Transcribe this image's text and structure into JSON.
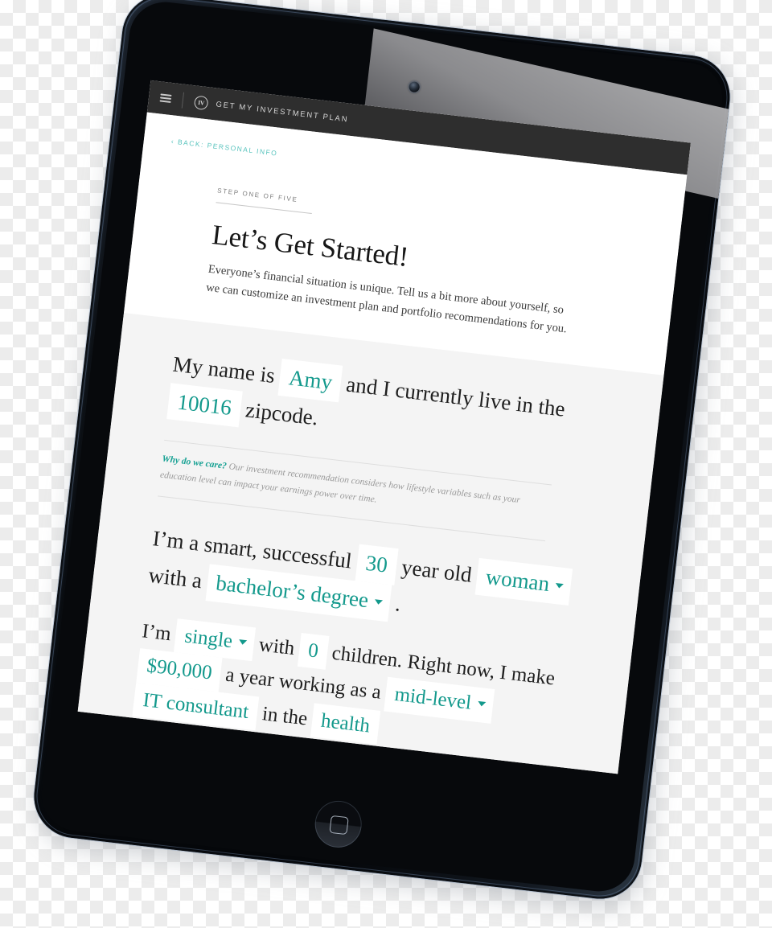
{
  "app": {
    "bar": {
      "menu_icon": "hamburger-icon",
      "logo_text": "IV",
      "title": "GET MY INVESTMENT PLAN"
    },
    "back_link": "‹ BACK: PERSONAL INFO"
  },
  "intro": {
    "step_label": "STEP ONE OF FIVE",
    "headline": "Let’s Get Started!",
    "blurb": "Everyone’s financial situation is unique. Tell us a bit more about yourself, so we can customize an investment plan and portfolio recommendations for you."
  },
  "form": {
    "identity": {
      "t1": "My name is",
      "name_value": "Amy",
      "t2": "and I currently",
      "t3": "live in the",
      "zip_value": "10016",
      "t4": "zipcode."
    },
    "note": {
      "lead": "Why do we care?",
      "body": " Our investment recommendation considers how lifestyle variables such as your education level can impact your earnings power over time."
    },
    "demographics": {
      "t1": "I’m a smart, successful",
      "age_value": "30",
      "t2": "year old",
      "gender_value": "woman",
      "t3": "with a",
      "education_value": "bachelor’s degree",
      "t4": "."
    },
    "household": {
      "t1": "I’m",
      "marital_value": "single",
      "t2": "with",
      "children_value": "0",
      "t3": "children.",
      "t4": "Right now, I make",
      "income_value": "$90,000",
      "t5": "a year",
      "t6": "working as a",
      "seniority_value": "mid-level",
      "role_value": "IT consultant",
      "t7": "in the",
      "industry_value": "health"
    }
  },
  "colors": {
    "accent_teal": "#13998c",
    "link_teal": "#57c3bd",
    "appbar": "#2e2e2e",
    "form_bg": "#f4f4f4"
  }
}
